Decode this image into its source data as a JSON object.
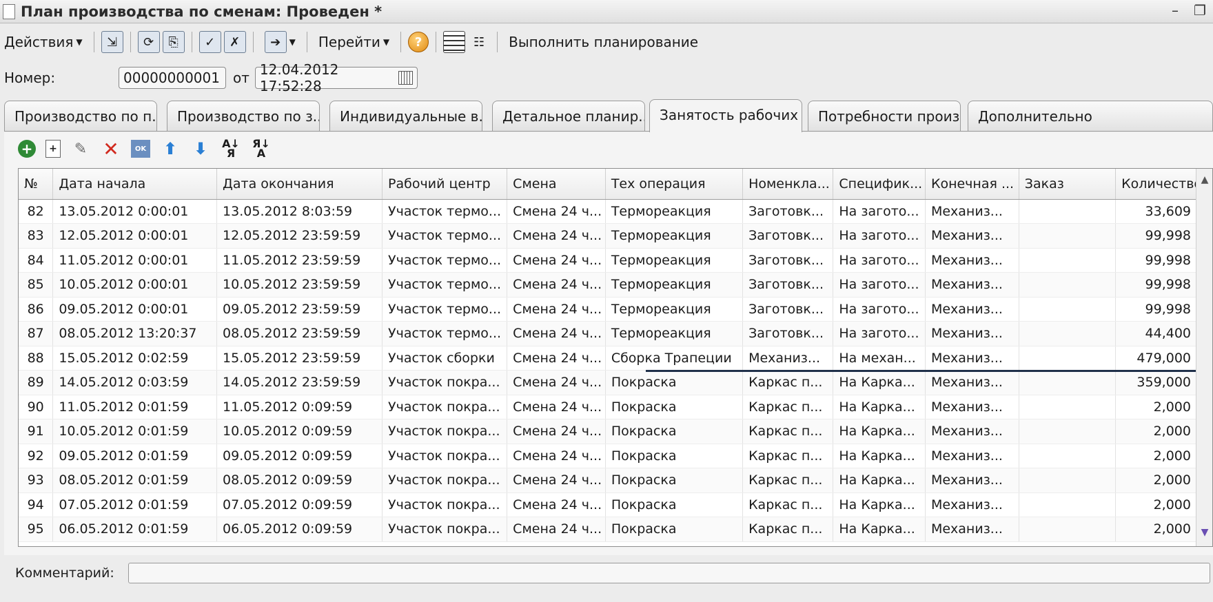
{
  "window": {
    "title": "План производства по сменам: Проведен *"
  },
  "toolbar": {
    "actions_label": "Действия",
    "goto_label": "Перейти",
    "run_planning_label": "Выполнить планирование"
  },
  "header": {
    "number_label": "Номер:",
    "number_value": "00000000001",
    "date_prefix": "от",
    "date_value": "12.04.2012 17:52:28"
  },
  "tabs": [
    {
      "label": "Производство по п..."
    },
    {
      "label": "Производство по з..."
    },
    {
      "label": "Индивидуальные в..."
    },
    {
      "label": "Детальное планир..."
    },
    {
      "label": "Занятость рабочих ..."
    },
    {
      "label": "Потребности произ..."
    },
    {
      "label": "Дополнительно"
    }
  ],
  "active_tab_index": 4,
  "table": {
    "columns": [
      "№",
      "Дата начала",
      "Дата окончания",
      "Рабочий центр",
      "Смена",
      "Тех операция",
      "Номенкла...",
      "Специфик...",
      "Конечная ...",
      "Заказ",
      "Количество"
    ],
    "rows": [
      [
        "82",
        "13.05.2012 0:00:01",
        "13.05.2012 8:03:59",
        "Участок термо...",
        "Смена 24 ч...",
        "Термореакция",
        "Заготовк...",
        "На загото...",
        "Механиз...",
        "",
        "33,609"
      ],
      [
        "83",
        "12.05.2012 0:00:01",
        "12.05.2012 23:59:59",
        "Участок термо...",
        "Смена 24 ч...",
        "Термореакция",
        "Заготовк...",
        "На загото...",
        "Механиз...",
        "",
        "99,998"
      ],
      [
        "84",
        "11.05.2012 0:00:01",
        "11.05.2012 23:59:59",
        "Участок термо...",
        "Смена 24 ч...",
        "Термореакция",
        "Заготовк...",
        "На загото...",
        "Механиз...",
        "",
        "99,998"
      ],
      [
        "85",
        "10.05.2012 0:00:01",
        "10.05.2012 23:59:59",
        "Участок термо...",
        "Смена 24 ч...",
        "Термореакция",
        "Заготовк...",
        "На загото...",
        "Механиз...",
        "",
        "99,998"
      ],
      [
        "86",
        "09.05.2012 0:00:01",
        "09.05.2012 23:59:59",
        "Участок термо...",
        "Смена 24 ч...",
        "Термореакция",
        "Заготовк...",
        "На загото...",
        "Механиз...",
        "",
        "99,998"
      ],
      [
        "87",
        "08.05.2012 13:20:37",
        "08.05.2012 23:59:59",
        "Участок термо...",
        "Смена 24 ч...",
        "Термореакция",
        "Заготовк...",
        "На загото...",
        "Механиз...",
        "",
        "44,400"
      ],
      [
        "88",
        "15.05.2012 0:02:59",
        "15.05.2012 23:59:59",
        "Участок сборки",
        "Смена 24 ч...",
        "Сборка Трапеции",
        "Механиз...",
        "На механ...",
        "Механиз...",
        "",
        "479,000"
      ],
      [
        "89",
        "14.05.2012 0:03:59",
        "14.05.2012 23:59:59",
        "Участок покра...",
        "Смена 24 ч...",
        "Покраска",
        "Каркас п...",
        "На Карка...",
        "Механиз...",
        "",
        "359,000"
      ],
      [
        "90",
        "11.05.2012 0:01:59",
        "11.05.2012 0:09:59",
        "Участок покра...",
        "Смена 24 ч...",
        "Покраска",
        "Каркас п...",
        "На Карка...",
        "Механиз...",
        "",
        "2,000"
      ],
      [
        "91",
        "10.05.2012 0:01:59",
        "10.05.2012 0:09:59",
        "Участок покра...",
        "Смена 24 ч...",
        "Покраска",
        "Каркас п...",
        "На Карка...",
        "Механиз...",
        "",
        "2,000"
      ],
      [
        "92",
        "09.05.2012 0:01:59",
        "09.05.2012 0:09:59",
        "Участок покра...",
        "Смена 24 ч...",
        "Покраска",
        "Каркас п...",
        "На Карка...",
        "Механиз...",
        "",
        "2,000"
      ],
      [
        "93",
        "08.05.2012 0:01:59",
        "08.05.2012 0:09:59",
        "Участок покра...",
        "Смена 24 ч...",
        "Покраска",
        "Каркас п...",
        "На Карка...",
        "Механиз...",
        "",
        "2,000"
      ],
      [
        "94",
        "07.05.2012 0:01:59",
        "07.05.2012 0:09:59",
        "Участок покра...",
        "Смена 24 ч...",
        "Покраска",
        "Каркас п...",
        "На Карка...",
        "Механиз...",
        "",
        "2,000"
      ],
      [
        "95",
        "06.05.2012 0:01:59",
        "06.05.2012 0:09:59",
        "Участок покра...",
        "Смена 24 ч...",
        "Покраска",
        "Каркас п...",
        "На Карка...",
        "Механиз...",
        "",
        "2,000"
      ]
    ]
  },
  "footer": {
    "comment_label": "Комментарий:",
    "comment_value": ""
  }
}
